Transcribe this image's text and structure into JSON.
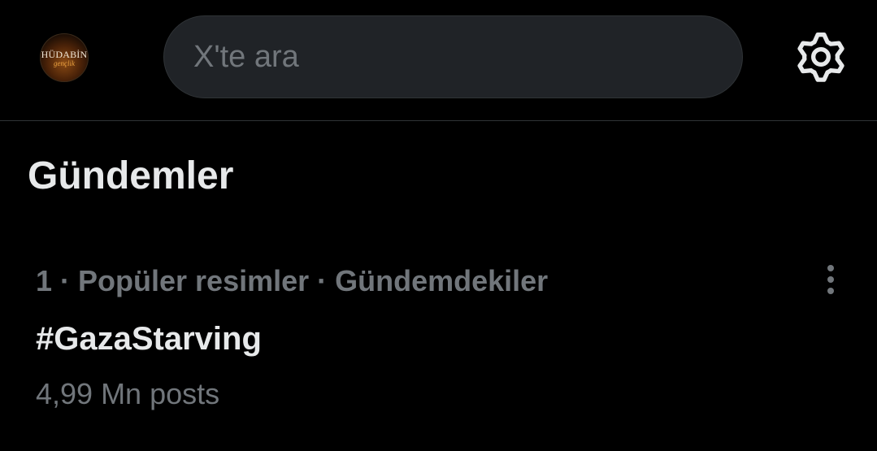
{
  "header": {
    "avatar": {
      "logo_top": "HÜDABİN",
      "logo_bottom": "gençlik"
    },
    "search": {
      "placeholder": "X'te ara",
      "value": ""
    },
    "settings_icon": "gear-icon"
  },
  "main": {
    "section_title": "Gündemler",
    "trends": [
      {
        "meta": "1 · Popüler resimler · Gündemdekiler",
        "name": "#GazaStarving",
        "count": "4,99 Mn posts",
        "more_icon": "more-vertical-icon"
      }
    ]
  },
  "colors": {
    "background": "#000000",
    "text_primary": "#e7e9ea",
    "text_secondary": "#71767b",
    "search_bg": "#202327",
    "divider": "#2f3336"
  }
}
